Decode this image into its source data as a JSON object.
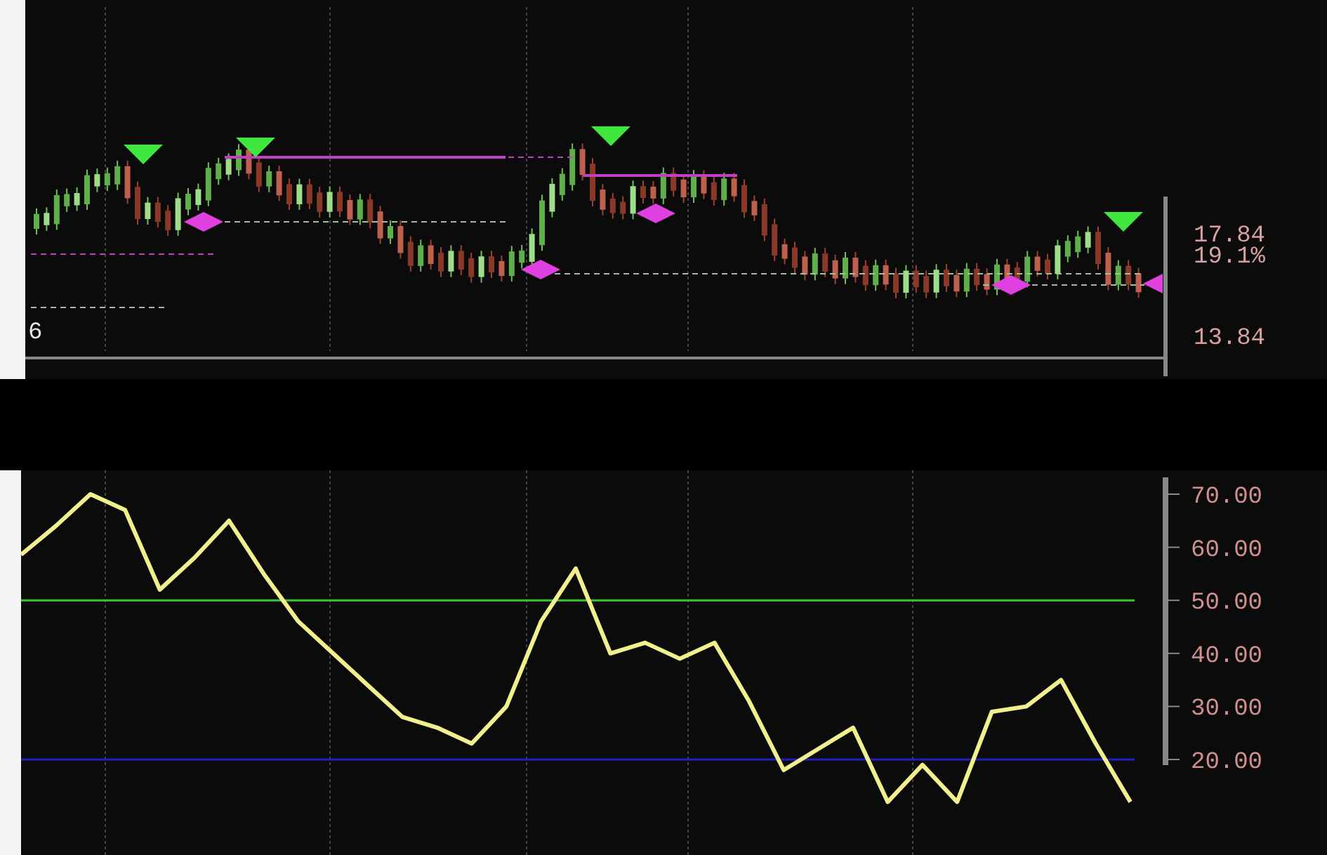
{
  "price_chart": {
    "left_label": "6",
    "price_labels": [
      "17.84",
      "19.1%",
      "13.84"
    ]
  },
  "indicator_chart": {
    "chart_data": {
      "type": "line",
      "ylim": [
        2,
        74.5
      ],
      "yticks": [
        {
          "value": 70,
          "label": "70.00"
        },
        {
          "value": 60,
          "label": "60.00"
        },
        {
          "value": 50,
          "label": "50.00"
        },
        {
          "value": 40,
          "label": "40.00"
        },
        {
          "value": 30,
          "label": "30.00"
        },
        {
          "value": 20,
          "label": "20.00"
        }
      ],
      "series": [
        {
          "color": "#f2f08c",
          "values": [
            58.6,
            64,
            70,
            67,
            52,
            58,
            65,
            55,
            46,
            40,
            34,
            28,
            26,
            23,
            30,
            46,
            56,
            40,
            42,
            39,
            42,
            31,
            18,
            22,
            26,
            12,
            19,
            12,
            29,
            30,
            35,
            23,
            12
          ]
        }
      ],
      "ref_lines": [
        {
          "axis": "y",
          "value": 50,
          "color": "#33c833"
        },
        {
          "axis": "y",
          "value": 20,
          "color": "#2020c0"
        }
      ]
    }
  }
}
